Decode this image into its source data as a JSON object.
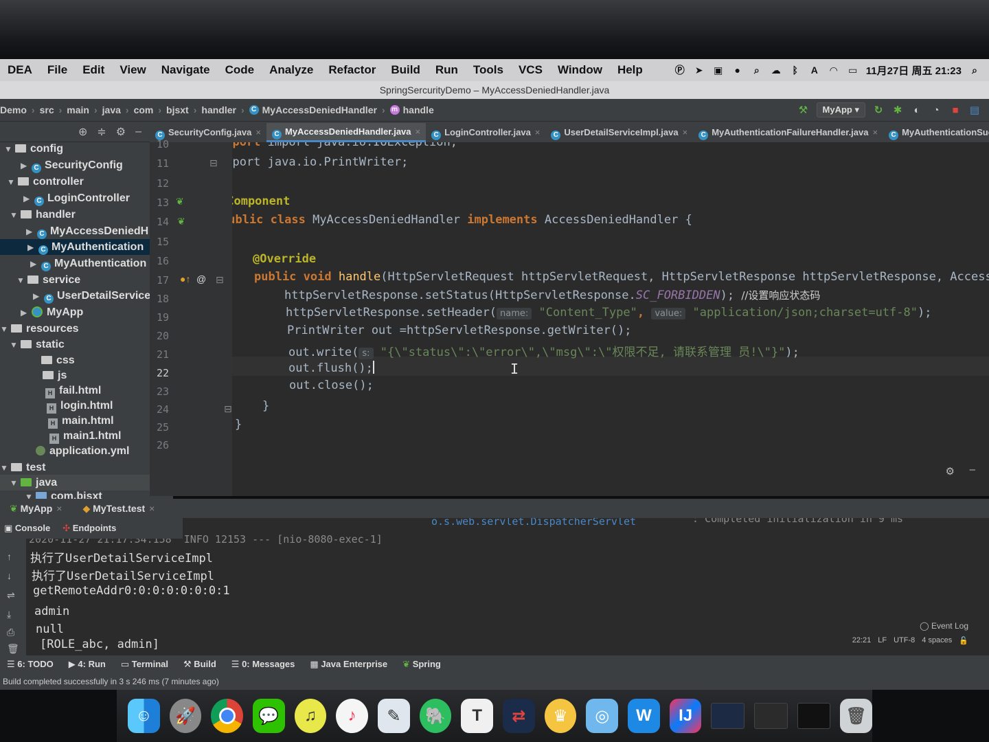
{
  "menubar": {
    "app": "DEA",
    "items": [
      "File",
      "Edit",
      "View",
      "Navigate",
      "Code",
      "Analyze",
      "Refactor",
      "Build",
      "Run",
      "Tools",
      "VCS",
      "Window",
      "Help"
    ],
    "datetime": "11月27日 周五 21:23",
    "tray_a": "A"
  },
  "window": {
    "title": "SpringSercurityDemo – MyAccessDeniedHandler.java"
  },
  "breadcrumb": [
    "Demo",
    "src",
    "main",
    "java",
    "com",
    "bjsxt",
    "handler",
    "MyAccessDeniedHandler",
    "handle"
  ],
  "run_config": "MyApp",
  "tabs": [
    {
      "label": "SecurityConfig.java"
    },
    {
      "label": "MyAccessDeniedHandler.java"
    },
    {
      "label": "LoginController.java"
    },
    {
      "label": "UserDetailServiceImpl.java"
    },
    {
      "label": "MyAuthenticationFailureHandler.java"
    },
    {
      "label": "MyAuthenticationSucc"
    }
  ],
  "tree": {
    "config": "config",
    "securityconfig": "SecurityConfig",
    "controller": "controller",
    "logincontroller": "LoginController",
    "handler": "handler",
    "myaccessdenied": "MyAccessDeniedH",
    "myauth1": "MyAuthentication",
    "myauth2": "MyAuthentication",
    "service": "service",
    "userdetailservice": "UserDetailService",
    "myapp": "MyApp",
    "resources": "resources",
    "static": "static",
    "css": "css",
    "js": "js",
    "fail": "fail.html",
    "login": "login.html",
    "main": "main.html",
    "main1": "main1.html",
    "appyml": "application.yml",
    "test": "test",
    "java": "java",
    "combjsxt": "com.bjsxt"
  },
  "lines": [
    "10",
    "11",
    "12",
    "13",
    "14",
    "15",
    "16",
    "17",
    "18",
    "19",
    "20",
    "21",
    "22",
    "23",
    "24",
    "25",
    "26"
  ],
  "code": {
    "l10": "import java.io.IOException;",
    "l11": "import java.io.PrintWriter;",
    "l13": "@Component",
    "l14_kw": "public class",
    "l14_name": "MyAccessDeniedHandler",
    "l14_impl": "implements",
    "l14_iface": "AccessDeniedHandler {",
    "l16": "@Override",
    "l17_kw": "public void",
    "l17_fn": "handle",
    "l17_rest": "(HttpServletRequest httpServletRequest, HttpServletResponse httpServletResponse, AccessDeniedE",
    "l18_a": "httpServletResponse.setStatus(HttpServletResponse.",
    "l18_const": "SC_FORBIDDEN",
    "l18_b": ");",
    "l18_comment": "//设置响应状态码",
    "l19_a": "httpServletResponse.setHeader(",
    "l19_hint1": "name:",
    "l19_s1": "\"Content_Type\"",
    "l19_comma": ",",
    "l19_hint2": "value:",
    "l19_s2": "\"application/json;charset=utf-8\"",
    "l19_b": ");",
    "l20": "PrintWriter out =httpServletResponse.getWriter();",
    "l21_a": "out.write(",
    "l21_hint": "s:",
    "l21_s": "\"{\\\"status\\\":\\\"error\\\",\\\"msg\\\":\\\"权限不足, 请联系管理 员!\\\"}\"",
    "l21_b": ");",
    "l22": "out.flush();",
    "l23": "out.close();",
    "l24": "}",
    "l25": "}"
  },
  "run": {
    "tab1": "MyApp",
    "tab2": "MyTest.test",
    "console_tab": "Console",
    "endpoints_tab": "Endpoints",
    "log_partial1": "2020-11-27 21:17:34.158  INFO 12153 --- [nio-8080-exec-1]",
    "log_partial2": "o.s.web.servlet.DispatcherServlet",
    "log_partial3": ": Completed initialization in 9 ms",
    "output": [
      "执行了UserDetailServiceImpl",
      "执行了UserDetailServiceImpl",
      "getRemoteAddr0:0:0:0:0:0:0:1",
      "admin",
      "null",
      "[ROLE_abc, admin]"
    ]
  },
  "bottom_tools": [
    "6: TODO",
    "4: Run",
    "Terminal",
    "Build",
    "0: Messages",
    "Java Enterprise",
    "Spring"
  ],
  "status": {
    "event_log": "Event Log",
    "position": "22:21",
    "line_sep": "LF",
    "encoding": "UTF-8",
    "indent": "4 spaces",
    "message": "Build completed successfully in 3 s 246 ms (7 minutes ago)"
  },
  "colors": {
    "keyword": "#cc7832",
    "annotation": "#bbb529",
    "string": "#6a8759",
    "accent": "#4a88c7"
  }
}
